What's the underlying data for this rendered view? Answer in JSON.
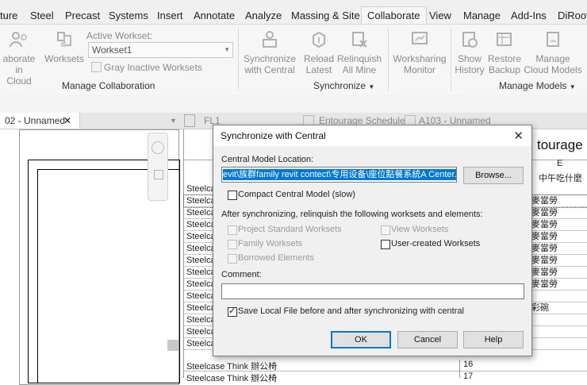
{
  "ribbon_tabs": [
    "ture",
    "Steel",
    "Precast",
    "Systems",
    "Insert",
    "Annotate",
    "Analyze",
    "Massing & Site",
    "Collaborate",
    "View",
    "Manage",
    "Add-Ins",
    "DiRoots"
  ],
  "ribbon": {
    "collaborate_in_cloud": "aborate in Cloud",
    "collaborate_line1": "aborate in",
    "collaborate_line2": "Cloud",
    "worksets": "Worksets",
    "active_workset_label": "Active Workset:",
    "active_workset_value": "Workset1",
    "gray_inactive": "Gray Inactive Worksets",
    "manage_collaboration": "Manage Collaboration",
    "sync_line1": "Synchronize",
    "sync_line2": "with Central",
    "reload_line1": "Reload",
    "reload_line2": "Latest",
    "relinquish_line1": "Relinquish",
    "relinquish_line2": "All Mine",
    "synchronize_panel": "Synchronize",
    "worksharing_line1": "Worksharing",
    "worksharing_line2": "Monitor",
    "show_line1": "Show",
    "show_line2": "History",
    "restore_line1": "Restore",
    "restore_line2": "Backup",
    "manage_line1": "Manage",
    "manage_line2": "Cloud Models",
    "manage_models_panel": "Manage Models"
  },
  "view_tabs": {
    "active": "02 - Unnamed",
    "t2": "FL1",
    "t3": "Entourage Schedule",
    "t4": "A103 - Unnamed"
  },
  "schedule": {
    "title": "tourage",
    "col_e": "E",
    "col_e_header": "中午吃什麼",
    "rows_left": [
      "Steelcas",
      "Steelcas",
      "Steelcas",
      "Steelcas",
      "Steelcas",
      "Steelcas",
      "Steelcas",
      "Steelcas",
      "Steelcas",
      "Steelcas",
      "Steelcas",
      "Steelcas",
      "Steelcas",
      "Steelcas"
    ],
    "rows_right": [
      "麥當勞",
      "麥當勞",
      "麥當勞",
      "麥當勞",
      "麥當勞",
      "麥當勞",
      "麥當勞",
      "麥當勞",
      "",
      "彩碗"
    ],
    "bottom_rows": [
      {
        "name": "Steelcase Think 辦公椅",
        "num": "16"
      },
      {
        "name": "Steelcase Think 辦公椅",
        "num": "17"
      }
    ]
  },
  "dialog": {
    "title": "Synchronize with Central",
    "close": "✕",
    "central_label": "Central Model Location:",
    "central_value": "evit\\族群family revit contect\\专用设备\\座位點餐系統A Center.rvt",
    "browse": "Browse...",
    "compact": "Compact Central Model (slow)",
    "relinquish_heading": "After synchronizing, relinquish the following worksets and elements:",
    "project_standard": "Project Standard Worksets",
    "view_worksets": "View Worksets",
    "family_worksets": "Family Worksets",
    "user_created": "User-created Worksets",
    "borrowed": "Borrowed Elements",
    "comment_label": "Comment:",
    "comment_value": "",
    "save_local": "Save Local File before and after synchronizing with central",
    "ok": "OK",
    "cancel": "Cancel",
    "help": "Help"
  }
}
